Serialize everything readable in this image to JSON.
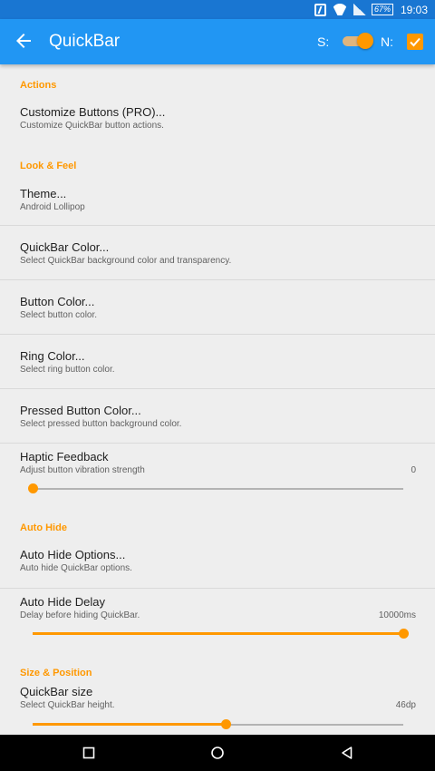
{
  "status_bar": {
    "battery": "67",
    "time": "19:03"
  },
  "app_bar": {
    "title": "QuickBar",
    "s_label": "S:",
    "n_label": "N:",
    "s_toggle_on": true,
    "n_checked": true
  },
  "colors": {
    "primary": "#2196f3",
    "primary_dark": "#1976d2",
    "accent": "#ff9800"
  },
  "sections": {
    "actions": {
      "header": "Actions",
      "customize": {
        "title": "Customize Buttons (PRO)...",
        "summary": "Customize QuickBar button actions."
      }
    },
    "look_feel": {
      "header": "Look & Feel",
      "theme": {
        "title": "Theme...",
        "summary": "Android Lollipop"
      },
      "quickbar_color": {
        "title": "QuickBar Color...",
        "summary": "Select QuickBar background color and transparency."
      },
      "button_color": {
        "title": "Button Color...",
        "summary": "Select button color."
      },
      "ring_color": {
        "title": "Ring Color...",
        "summary": "Select ring button color."
      },
      "pressed_color": {
        "title": "Pressed Button Color...",
        "summary": "Select pressed button background color."
      },
      "haptic": {
        "title": "Haptic Feedback",
        "summary": "Adjust button vibration strength",
        "value": "0",
        "level": 0.0
      }
    },
    "auto_hide": {
      "header": "Auto Hide",
      "options": {
        "title": "Auto Hide Options...",
        "summary": "Auto hide QuickBar options."
      },
      "delay": {
        "title": "Auto Hide Delay",
        "summary": "Delay before hiding QuickBar.",
        "value": "10000ms",
        "level": 1.0
      }
    },
    "size_position": {
      "header": "Size & Position",
      "size": {
        "title": "QuickBar size",
        "summary": "Select QuickBar height.",
        "value": "46dp",
        "level": 0.52
      }
    }
  },
  "nav_bar": {
    "icons": [
      "recents-icon",
      "home-icon",
      "back-icon"
    ]
  }
}
